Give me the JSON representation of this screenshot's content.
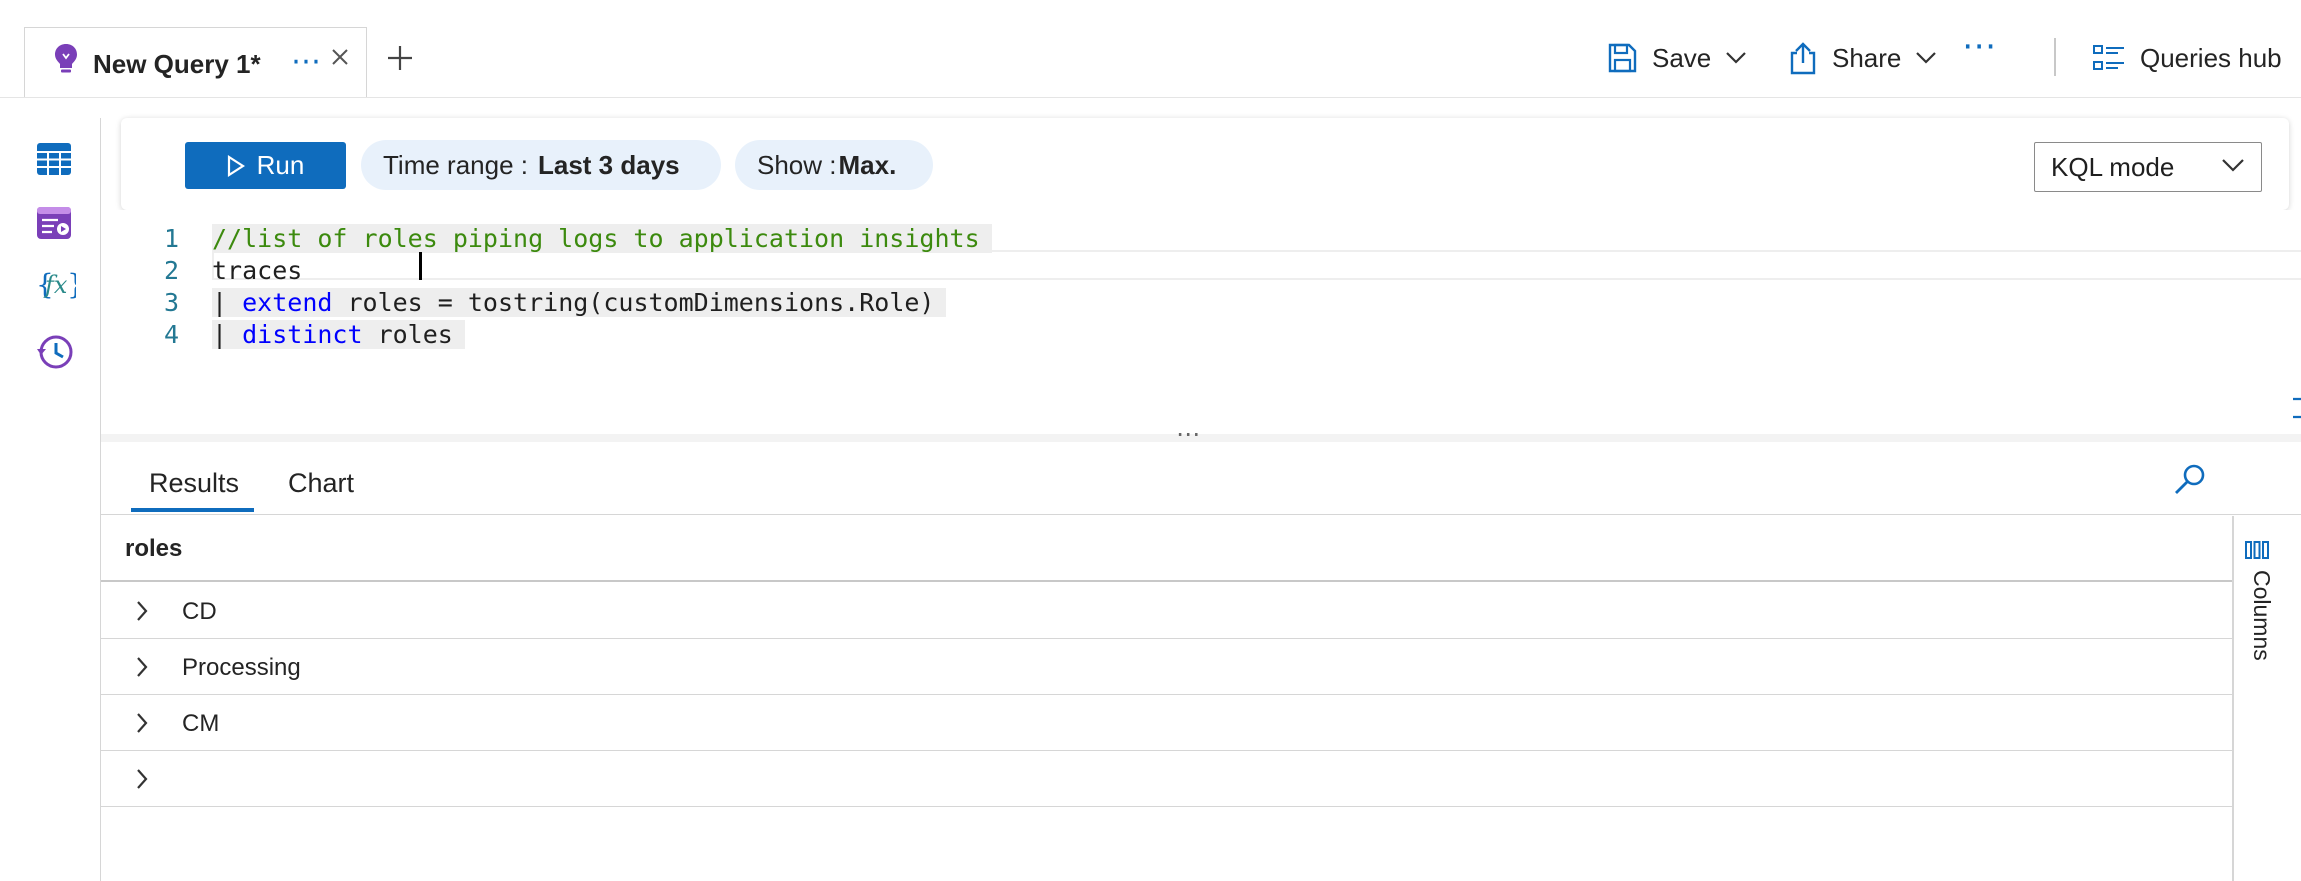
{
  "tabs": [
    {
      "title": "New Query 1*",
      "icon": "lightbulb-icon",
      "more": "⋯"
    }
  ],
  "toolbar": {
    "save_label": "Save",
    "share_label": "Share",
    "more": "⋯",
    "queries_hub_label": "Queries hub"
  },
  "query_bar": {
    "run_label": "Run",
    "time_range_label": "Time range : ",
    "time_range_value": "Last 3 days",
    "show_label": "Show : ",
    "show_value": "Max.",
    "mode_value": "KQL mode"
  },
  "editor": {
    "line_numbers": [
      "1",
      "2",
      "3",
      "4"
    ],
    "lines": [
      {
        "comment": "//list of roles piping logs to application insights"
      },
      {
        "text": "traces "
      },
      {
        "pipe": "| ",
        "keyword": "extend",
        "text": " roles = tostring(customDimensions.Role)"
      },
      {
        "pipe": "| ",
        "keyword": "distinct",
        "text": " roles"
      }
    ],
    "splitter_grip": "⋯"
  },
  "results": {
    "tabs": [
      "Results",
      "Chart"
    ],
    "active_tab": "Results",
    "column_header": "roles",
    "rows": [
      "CD",
      "Processing",
      "CM",
      ""
    ],
    "columns_panel_label": "Columns"
  },
  "colors": {
    "accent": "#0f6cbd",
    "comment": "#3c8a0e",
    "keyword": "#0000ff",
    "line_number": "#237893",
    "rail_icon": "#5b2d90"
  }
}
